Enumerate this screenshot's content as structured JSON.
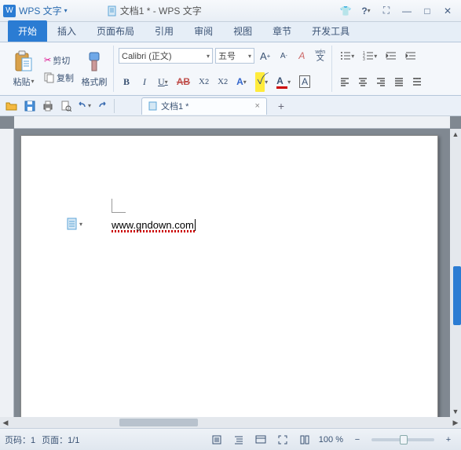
{
  "app": {
    "logo_letter": "W",
    "name": "WPS 文字"
  },
  "titlebar_doc": "文档1 * - WPS 文字",
  "tabs": [
    "开始",
    "插入",
    "页面布局",
    "引用",
    "审阅",
    "视图",
    "章节",
    "开发工具"
  ],
  "clipboard": {
    "cut": "剪切",
    "copy": "复制",
    "paste": "粘贴",
    "format_painter": "格式刷"
  },
  "font": {
    "name": "Calibri (正文)",
    "size": "五号",
    "wen": "文"
  },
  "doctab": {
    "label": "文档1 *"
  },
  "document_text": "www.gndown.com",
  "status": {
    "page_label": "页码：",
    "page": "1",
    "pages_label": "页面：",
    "pages": "1/1",
    "zoom": "100 %"
  },
  "icons": {
    "tshirt": "👕",
    "help": "?",
    "expand": "⛶",
    "min": "—",
    "max": "□",
    "close": "✕",
    "scissors": "✂",
    "caret": "▾",
    "increase": "A",
    "decrease": "A",
    "clear": "A",
    "list_b": "☰",
    "list_n": "☷",
    "indent_l": "≡",
    "indent_r": "≡",
    "al": "≡",
    "ac": "≡",
    "ar": "≡",
    "aj": "≡",
    "x": "×",
    "plus": "+",
    "zoom_out": "−",
    "zoom_in": "+"
  }
}
